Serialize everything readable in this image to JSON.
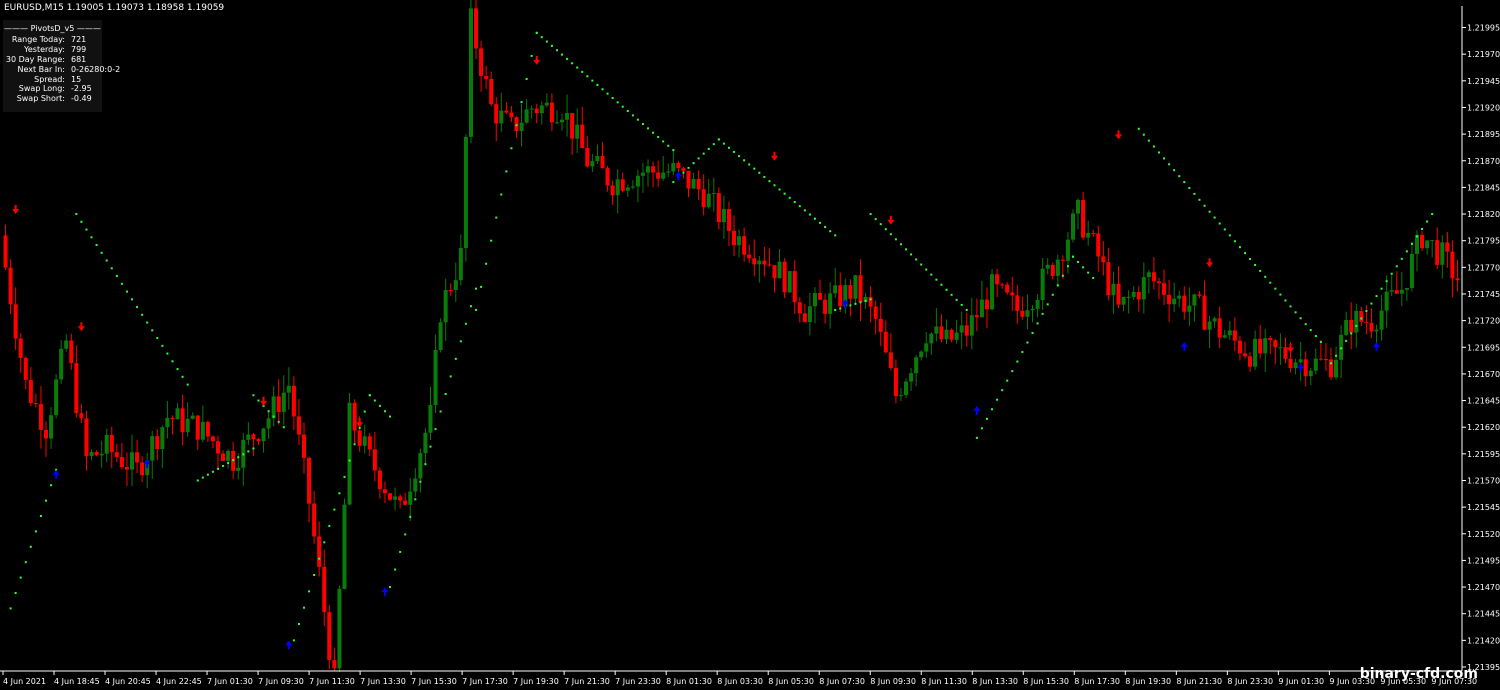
{
  "header": {
    "symbol_line": "EURUSD,M15  1.19005 1.19073 1.18958 1.19059"
  },
  "info_panel": {
    "title": "PivotsD_v5",
    "rows": [
      {
        "label": "Range  Today:",
        "value": "721"
      },
      {
        "label": "Yesterday:",
        "value": "799"
      },
      {
        "label": "30 Day Range:",
        "value": "681"
      },
      {
        "label": "Next Bar In:",
        "value": "0-26280:0-2"
      },
      {
        "label": "Spread:",
        "value": "15"
      },
      {
        "label": "Swap  Long:",
        "value": "-2.95"
      },
      {
        "label": "Swap  Short:",
        "value": "-0.49"
      }
    ]
  },
  "watermark": "binary-cfd.com",
  "colors": {
    "background": "#000000",
    "axis": "#ffffff",
    "bull_candle": "#0a7a0a",
    "bear_candle": "#ff0000",
    "sar_dots": "#33ff33",
    "up_arrow": "#0000ff",
    "down_arrow": "#ff0000"
  },
  "chart_data": {
    "type": "candlestick",
    "title": "",
    "xlabel": "",
    "ylabel": "",
    "ylim": [
      1.21395,
      1.22003
    ],
    "y_ticks": [
      "1.21995",
      "1.21970",
      "1.21945",
      "1.21920",
      "1.21895",
      "1.21870",
      "1.21845",
      "1.21820",
      "1.21795",
      "1.21770",
      "1.21745",
      "1.21720",
      "1.21695",
      "1.21670",
      "1.21645",
      "1.21620",
      "1.21595",
      "1.21570",
      "1.21545",
      "1.21520",
      "1.21495",
      "1.21470",
      "1.21445",
      "1.21420",
      "1.21395"
    ],
    "x_ticks": [
      "4 Jun 2021",
      "4 Jun 18:45",
      "4 Jun 20:45",
      "4 Jun 22:45",
      "7 Jun 01:30",
      "7 Jun 09:30",
      "7 Jun 11:30",
      "7 Jun 13:30",
      "7 Jun 15:30",
      "7 Jun 17:30",
      "7 Jun 19:30",
      "7 Jun 21:30",
      "7 Jun 23:30",
      "8 Jun 01:30",
      "8 Jun 03:30",
      "8 Jun 05:30",
      "8 Jun 07:30",
      "8 Jun 09:30",
      "8 Jun 11:30",
      "8 Jun 13:30",
      "8 Jun 15:30",
      "8 Jun 17:30",
      "8 Jun 19:30",
      "8 Jun 21:30",
      "8 Jun 23:30",
      "9 Jun 01:30",
      "9 Jun 03:30",
      "9 Jun 05:30",
      "9 Jun 07:30"
    ],
    "bar_count": 288,
    "close_path": [
      [
        0,
        1.2177
      ],
      [
        4,
        1.2166
      ],
      [
        8,
        1.2162
      ],
      [
        12,
        1.217
      ],
      [
        16,
        1.2159
      ],
      [
        20,
        1.216
      ],
      [
        26,
        1.2158
      ],
      [
        32,
        1.2163
      ],
      [
        38,
        1.2162
      ],
      [
        45,
        1.2159
      ],
      [
        52,
        1.2163
      ],
      [
        56,
        1.2166
      ],
      [
        60,
        1.2155
      ],
      [
        65,
        1.2138
      ],
      [
        68,
        1.2163
      ],
      [
        72,
        1.2159
      ],
      [
        78,
        1.2154
      ],
      [
        84,
        1.2163
      ],
      [
        86,
        1.2173
      ],
      [
        90,
        1.2178
      ],
      [
        92,
        1.22
      ],
      [
        96,
        1.2192
      ],
      [
        100,
        1.219
      ],
      [
        104,
        1.2192
      ],
      [
        110,
        1.2192
      ],
      [
        115,
        1.2187
      ],
      [
        120,
        1.2185
      ],
      [
        126,
        1.2186
      ],
      [
        132,
        1.2186
      ],
      [
        138,
        1.2184
      ],
      [
        144,
        1.218
      ],
      [
        150,
        1.2178
      ],
      [
        154,
        1.2176
      ],
      [
        158,
        1.2173
      ],
      [
        164,
        1.2174
      ],
      [
        168,
        1.2175
      ],
      [
        172,
        1.2172
      ],
      [
        176,
        1.2165
      ],
      [
        182,
        1.2171
      ],
      [
        186,
        1.217
      ],
      [
        190,
        1.2171
      ],
      [
        195,
        1.2175
      ],
      [
        200,
        1.2173
      ],
      [
        204,
        1.2175
      ],
      [
        208,
        1.2178
      ],
      [
        212,
        1.2182
      ],
      [
        216,
        1.2178
      ],
      [
        220,
        1.2173
      ],
      [
        226,
        1.2176
      ],
      [
        232,
        1.2174
      ],
      [
        236,
        1.2173
      ],
      [
        240,
        1.2171
      ],
      [
        246,
        1.2169
      ],
      [
        252,
        1.2169
      ],
      [
        258,
        1.2168
      ],
      [
        262,
        1.2168
      ],
      [
        266,
        1.2172
      ],
      [
        270,
        1.2172
      ],
      [
        276,
        1.2175
      ],
      [
        280,
        1.218
      ],
      [
        284,
        1.2178
      ],
      [
        287,
        1.2176
      ]
    ],
    "sar_segments": [
      {
        "from": [
          1,
          1.2145
        ],
        "to": [
          10,
          1.2158
        ]
      },
      {
        "from": [
          14,
          1.2182
        ],
        "to": [
          36,
          1.2166
        ]
      },
      {
        "from": [
          38,
          1.2157
        ],
        "to": [
          49,
          1.216
        ]
      },
      {
        "from": [
          49,
          1.2165
        ],
        "to": [
          55,
          1.2162
        ]
      },
      {
        "from": [
          57,
          1.2142
        ],
        "to": [
          72,
          1.2165
        ]
      },
      {
        "from": [
          72,
          1.2165
        ],
        "to": [
          76,
          1.2163
        ]
      },
      {
        "from": [
          76,
          1.2147
        ],
        "to": [
          93,
          1.2175
        ]
      },
      {
        "from": [
          93,
          1.2173
        ],
        "to": [
          105,
          1.2199
        ]
      },
      {
        "from": [
          105,
          1.2199
        ],
        "to": [
          132,
          1.2188
        ]
      },
      {
        "from": [
          132,
          1.2185
        ],
        "to": [
          141,
          1.2189
        ]
      },
      {
        "from": [
          141,
          1.2189
        ],
        "to": [
          164,
          1.218
        ]
      },
      {
        "from": [
          164,
          1.2173
        ],
        "to": [
          171,
          1.2174
        ]
      },
      {
        "from": [
          171,
          1.2182
        ],
        "to": [
          190,
          1.2173
        ]
      },
      {
        "from": [
          192,
          1.2161
        ],
        "to": [
          211,
          1.2178
        ]
      },
      {
        "from": [
          211,
          1.2178
        ],
        "to": [
          215,
          1.2176
        ]
      },
      {
        "from": [
          224,
          1.219
        ],
        "to": [
          260,
          1.217
        ]
      },
      {
        "from": [
          262,
          1.2168
        ],
        "to": [
          282,
          1.2182
        ]
      }
    ],
    "up_arrows": [
      [
        10,
        1.2158
      ],
      [
        28,
        1.2159
      ],
      [
        56,
        1.2142
      ],
      [
        75,
        1.2147
      ],
      [
        133,
        1.2186
      ],
      [
        166,
        1.2174
      ],
      [
        192,
        1.2164
      ],
      [
        233,
        1.217
      ],
      [
        256,
        1.2168
      ],
      [
        271,
        1.217
      ]
    ],
    "down_arrows": [
      [
        2,
        1.2182
      ],
      [
        15,
        1.2171
      ],
      [
        51,
        1.2164
      ],
      [
        70,
        1.2162
      ],
      [
        105,
        1.2196
      ],
      [
        152,
        1.2187
      ],
      [
        175,
        1.2181
      ],
      [
        220,
        1.2189
      ],
      [
        238,
        1.2177
      ],
      [
        254,
        1.2169
      ]
    ]
  }
}
